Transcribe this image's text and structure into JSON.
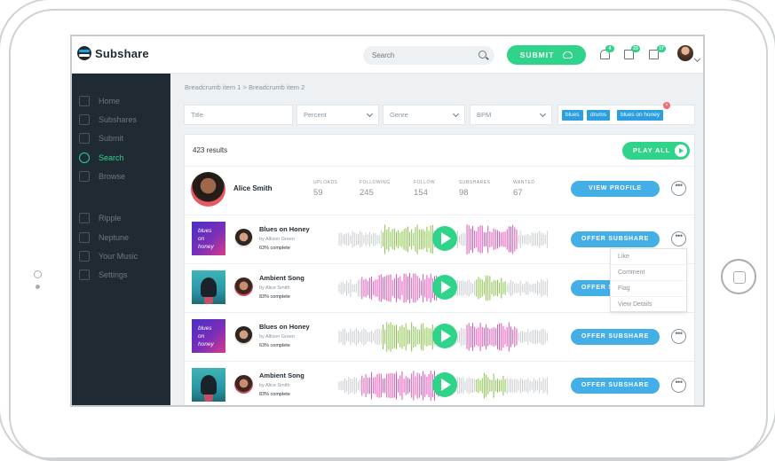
{
  "app": {
    "logo_text": "Subshare"
  },
  "topbar": {
    "search_placeholder": "Search",
    "submit_label": "SUBMIT",
    "badges": {
      "notifications": "4",
      "messages": "23",
      "calendar": "17"
    }
  },
  "sidebar": {
    "items": [
      {
        "label": "Home",
        "icon": "home-icon"
      },
      {
        "label": "Subshares",
        "icon": "globe-icon"
      },
      {
        "label": "Submit",
        "icon": "cloud-upload-icon"
      },
      {
        "label": "Search",
        "icon": "search-icon",
        "active": true
      },
      {
        "label": "Browse",
        "icon": "compass-icon"
      },
      {
        "label": "Ripple",
        "icon": "ripple-icon"
      },
      {
        "label": "Neptune",
        "icon": "neptune-icon"
      },
      {
        "label": "Your Music",
        "icon": "music-icon"
      },
      {
        "label": "Settings",
        "icon": "gear-icon"
      }
    ]
  },
  "breadcrumb": {
    "item1": "Breadcrumb item 1",
    "separator": ">",
    "item2": "Breadcrumb item 2"
  },
  "filters": {
    "title_placeholder": "Title",
    "percent": "Percent",
    "genre": "Genre",
    "bpm": "BPM",
    "tags": [
      "blues",
      "drums",
      "blues on honey"
    ]
  },
  "results": {
    "count_text": "423 results",
    "play_all_label": "PLAY ALL"
  },
  "profile": {
    "name": "Alice Smith",
    "stats": [
      {
        "label": "UPLOADS",
        "value": "59"
      },
      {
        "label": "FOLLOWING",
        "value": "245"
      },
      {
        "label": "FOLLOW",
        "value": "154"
      },
      {
        "label": "SUBSHARES",
        "value": "98"
      },
      {
        "label": "WANTED",
        "value": "67"
      }
    ],
    "view_profile_label": "VIEW PROFILE"
  },
  "songs": [
    {
      "title": "Blues on Honey",
      "by": "by Allison Green",
      "complete": "63% complete",
      "art_text": [
        "blues",
        "on",
        "honey"
      ],
      "button": "OFFER SUBSHARE"
    },
    {
      "title": "Ambient Song",
      "by": "by Alice Smith",
      "complete": "83% complete",
      "button": "OFFER SUBSHARE"
    },
    {
      "title": "Blues on Honey",
      "by": "by Allison Green",
      "complete": "63% complete",
      "art_text": [
        "blues",
        "on",
        "honey"
      ],
      "button": "OFFER SUBSHARE"
    },
    {
      "title": "Ambient Song",
      "by": "by Alice Smith",
      "complete": "83% complete",
      "button": "OFFER SUBSHARE"
    }
  ],
  "dropdown": {
    "items": [
      "Like",
      "Comment",
      "Flag",
      "View Details"
    ]
  },
  "colors": {
    "accent_green": "#2fd48a",
    "accent_blue": "#44aee6",
    "sidebar_bg": "#1f2a33",
    "wave_green": "#8bc34a",
    "wave_pink": "#e054b8"
  }
}
